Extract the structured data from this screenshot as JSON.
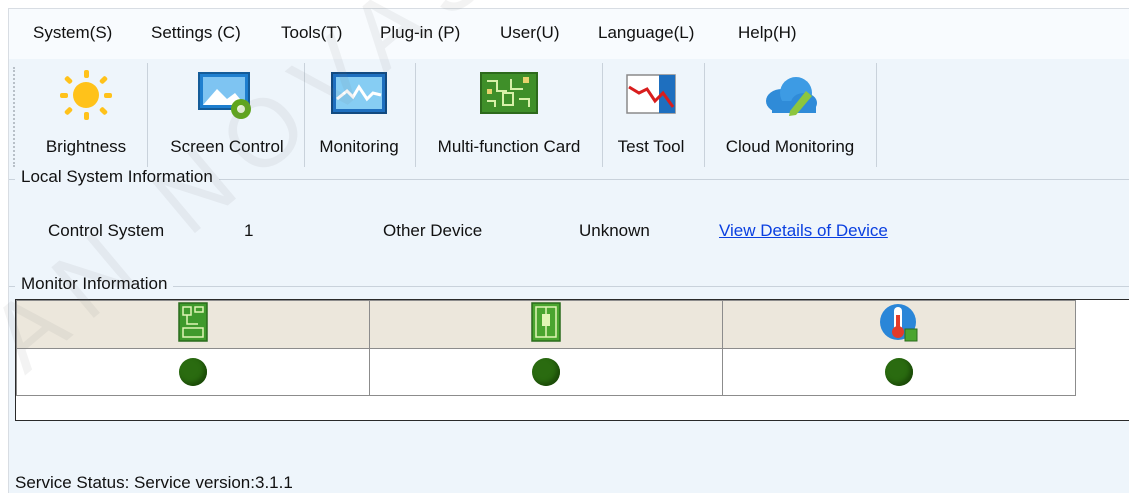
{
  "menubar": {
    "items": [
      "System(S)",
      "Settings (C)",
      "Tools(T)",
      "Plug-in (P)",
      "User(U)",
      "Language(L)",
      "Help(H)"
    ]
  },
  "toolbar": {
    "buttons": [
      {
        "label": "Brightness",
        "icon": "sun-icon"
      },
      {
        "label": "Screen Control",
        "icon": "screen-control-icon"
      },
      {
        "label": "Monitoring",
        "icon": "monitor-wave-icon"
      },
      {
        "label": "Multi-function Card",
        "icon": "circuit-card-icon"
      },
      {
        "label": "Test Tool",
        "icon": "chart-test-icon"
      },
      {
        "label": "Cloud Monitoring",
        "icon": "cloud-edit-icon"
      }
    ]
  },
  "local_system": {
    "title": "Local System Information",
    "control_system_label": "Control System",
    "control_system_value": "1",
    "other_device_label": "Other Device",
    "other_device_value": "Unknown",
    "details_link": "View Details of Device"
  },
  "monitor": {
    "title": "Monitor Information",
    "columns": [
      {
        "icon": "receiving-card-icon",
        "status_color": "#2a6b10"
      },
      {
        "icon": "chip-card-icon",
        "status_color": "#2a6b10"
      },
      {
        "icon": "temperature-icon",
        "status_color": "#2a6b10"
      }
    ]
  },
  "status_bar": {
    "text": "Service Status:  Service version:3.1.1"
  },
  "watermark": "AN NOVASTAR"
}
